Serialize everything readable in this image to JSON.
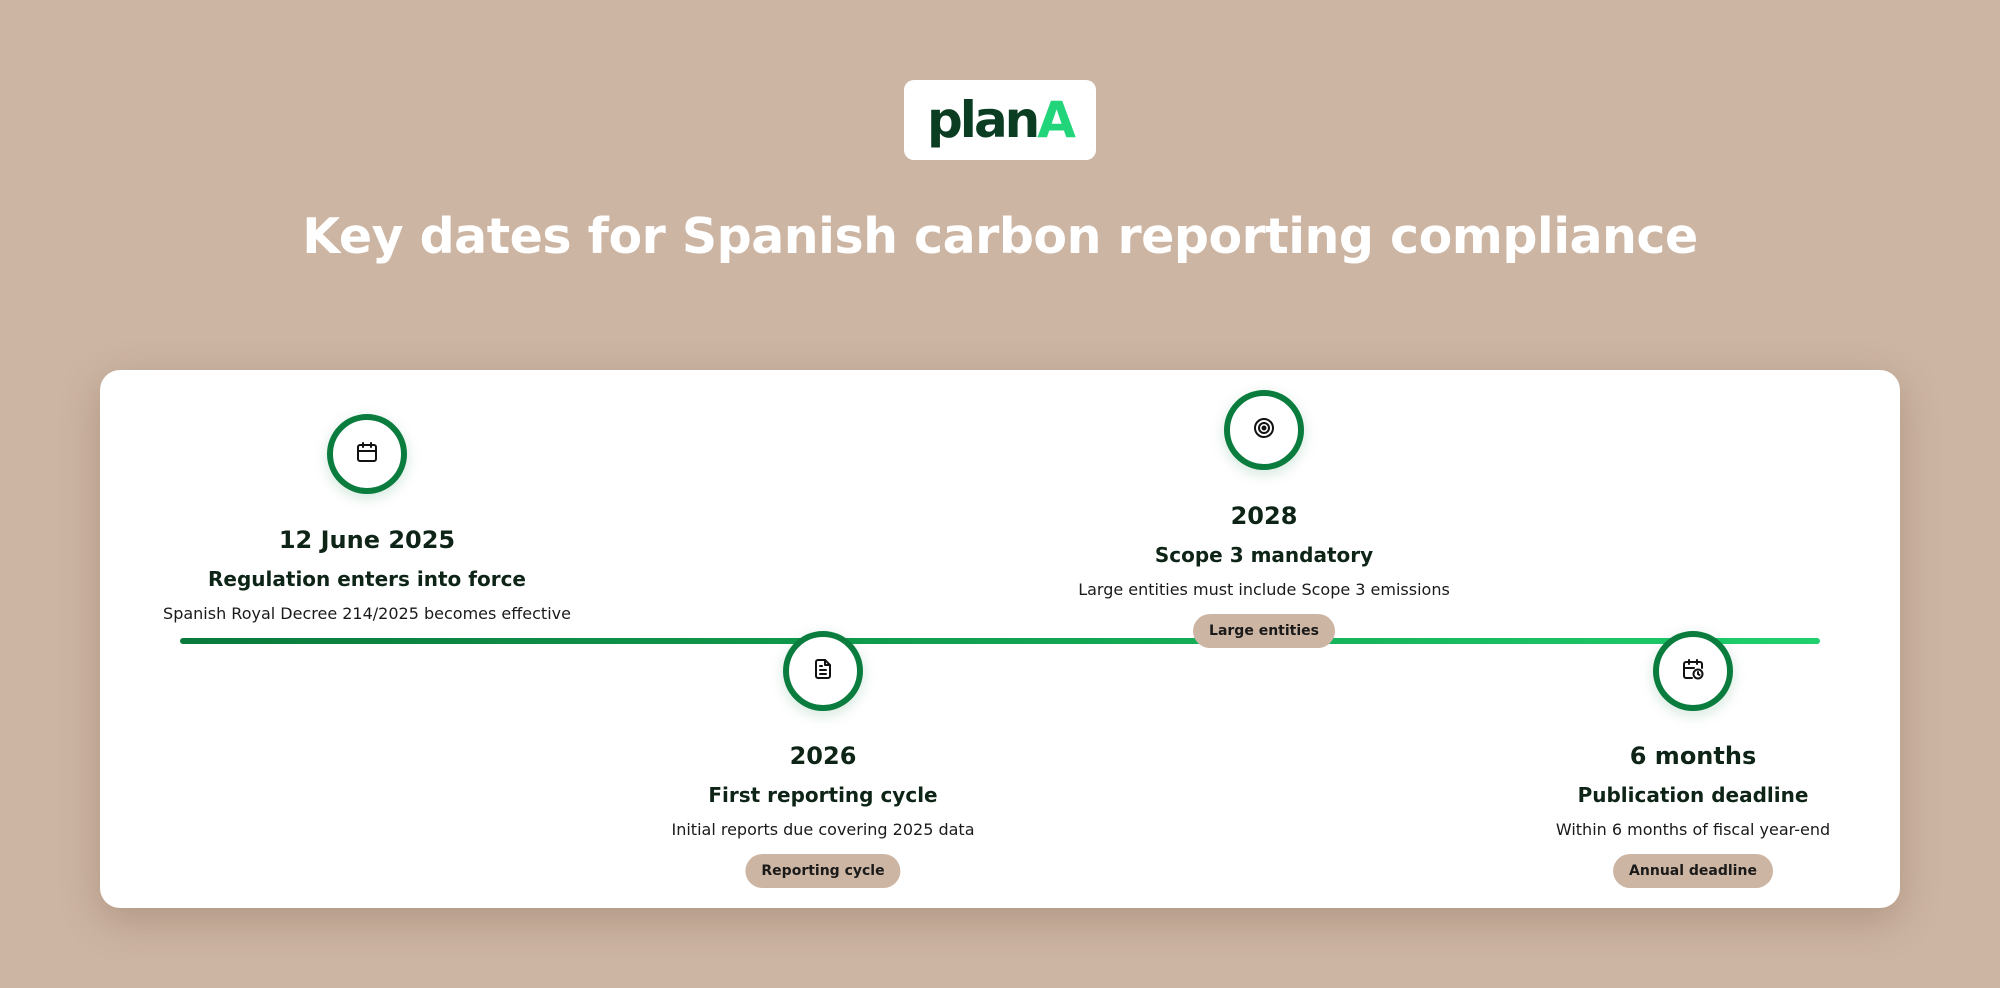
{
  "logo": {
    "part1": "plan",
    "part2": "A"
  },
  "header": {
    "title": "Key dates for Spanish carbon reporting compliance"
  },
  "milestones": [
    {
      "icon": "calendar-icon",
      "date": "12 June 2025",
      "title": "Regulation enters into force",
      "description": "Spanish Royal Decree 214/2025 becomes effective",
      "badge": ""
    },
    {
      "icon": "document-icon",
      "date": "2026",
      "title": "First reporting cycle",
      "description": "Initial reports due covering 2025 data",
      "badge": "Reporting cycle"
    },
    {
      "icon": "target-icon",
      "date": "2028",
      "title": "Scope 3 mandatory",
      "description": "Large entities must include Scope 3 emissions",
      "badge": "Large entities"
    },
    {
      "icon": "calendar-clock-icon",
      "date": "6 months",
      "title": "Publication deadline",
      "description": "Within 6 months of fiscal year-end",
      "badge": "Annual deadline"
    }
  ],
  "colors": {
    "background": "#cdb5a3",
    "accent_green": "#0a7c3e",
    "logo_dark": "#0b3d23",
    "logo_light": "#22d47a",
    "badge": "#cdb5a3"
  }
}
